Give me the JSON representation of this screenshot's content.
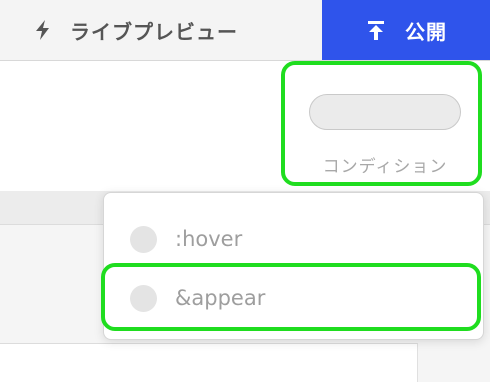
{
  "toolbar": {
    "live_preview_label": "ライブプレビュー",
    "live_preview_icon": "bolt-icon",
    "publish_label": "公開",
    "publish_icon": "upload-icon"
  },
  "condition": {
    "label": "コンディション"
  },
  "dropdown": {
    "items": [
      {
        "label": ":hover"
      },
      {
        "label": "&appear"
      }
    ]
  },
  "colors": {
    "publish_bg": "#2f54eb",
    "highlight": "#1fdd1f"
  }
}
